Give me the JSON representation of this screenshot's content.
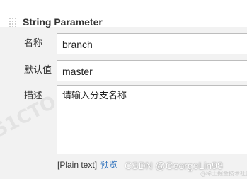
{
  "section": {
    "title": "String Parameter"
  },
  "fields": {
    "name_label": "名称",
    "name_value": "branch",
    "default_label": "默认值",
    "default_value": "master",
    "description_label": "描述",
    "description_value": "请输入分支名称"
  },
  "footer": {
    "format_text": "[Plain text]",
    "preview_link": "预览"
  },
  "watermark": {
    "main": "CSDN @GeorgeLin98",
    "sub": "@稀土掘金技术社区"
  }
}
